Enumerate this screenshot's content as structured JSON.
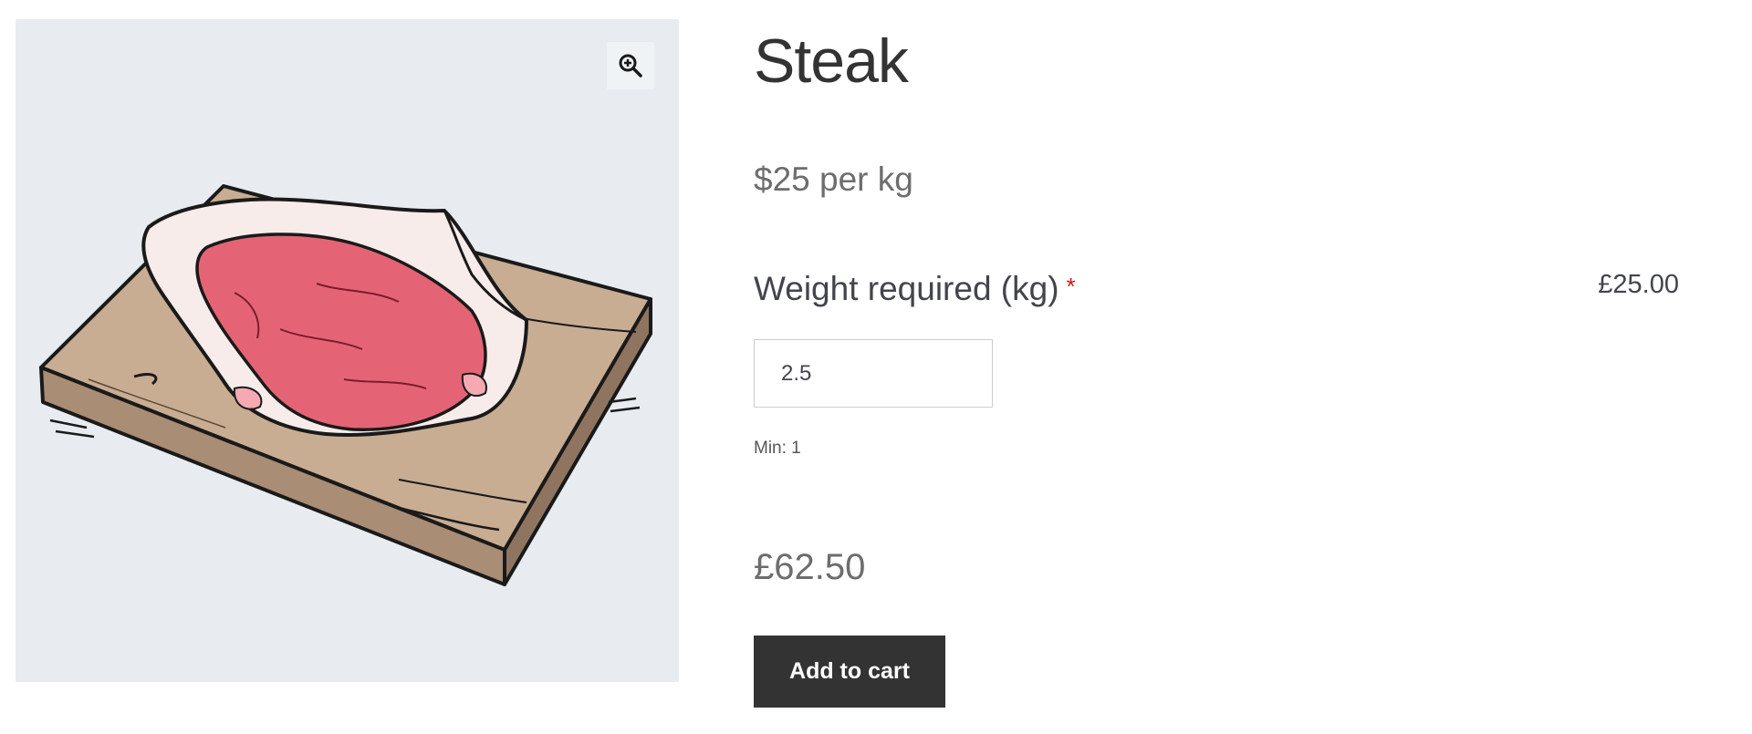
{
  "product": {
    "title": "Steak",
    "unit_price": "$25 per kg",
    "image_icon": "steak-on-cutting-board-illustration",
    "zoom_icon": "zoom-in-icon"
  },
  "weight_field": {
    "label": "Weight required (kg)",
    "required_mark": "*",
    "value": "2.5",
    "min_note": "Min: 1",
    "option_price": "£25.00"
  },
  "totals": {
    "price": "£62.50"
  },
  "actions": {
    "add_to_cart_label": "Add to cart"
  },
  "colors": {
    "button_bg": "#333333",
    "required": "#cc1818",
    "gallery_bg": "#e8ecf1"
  }
}
